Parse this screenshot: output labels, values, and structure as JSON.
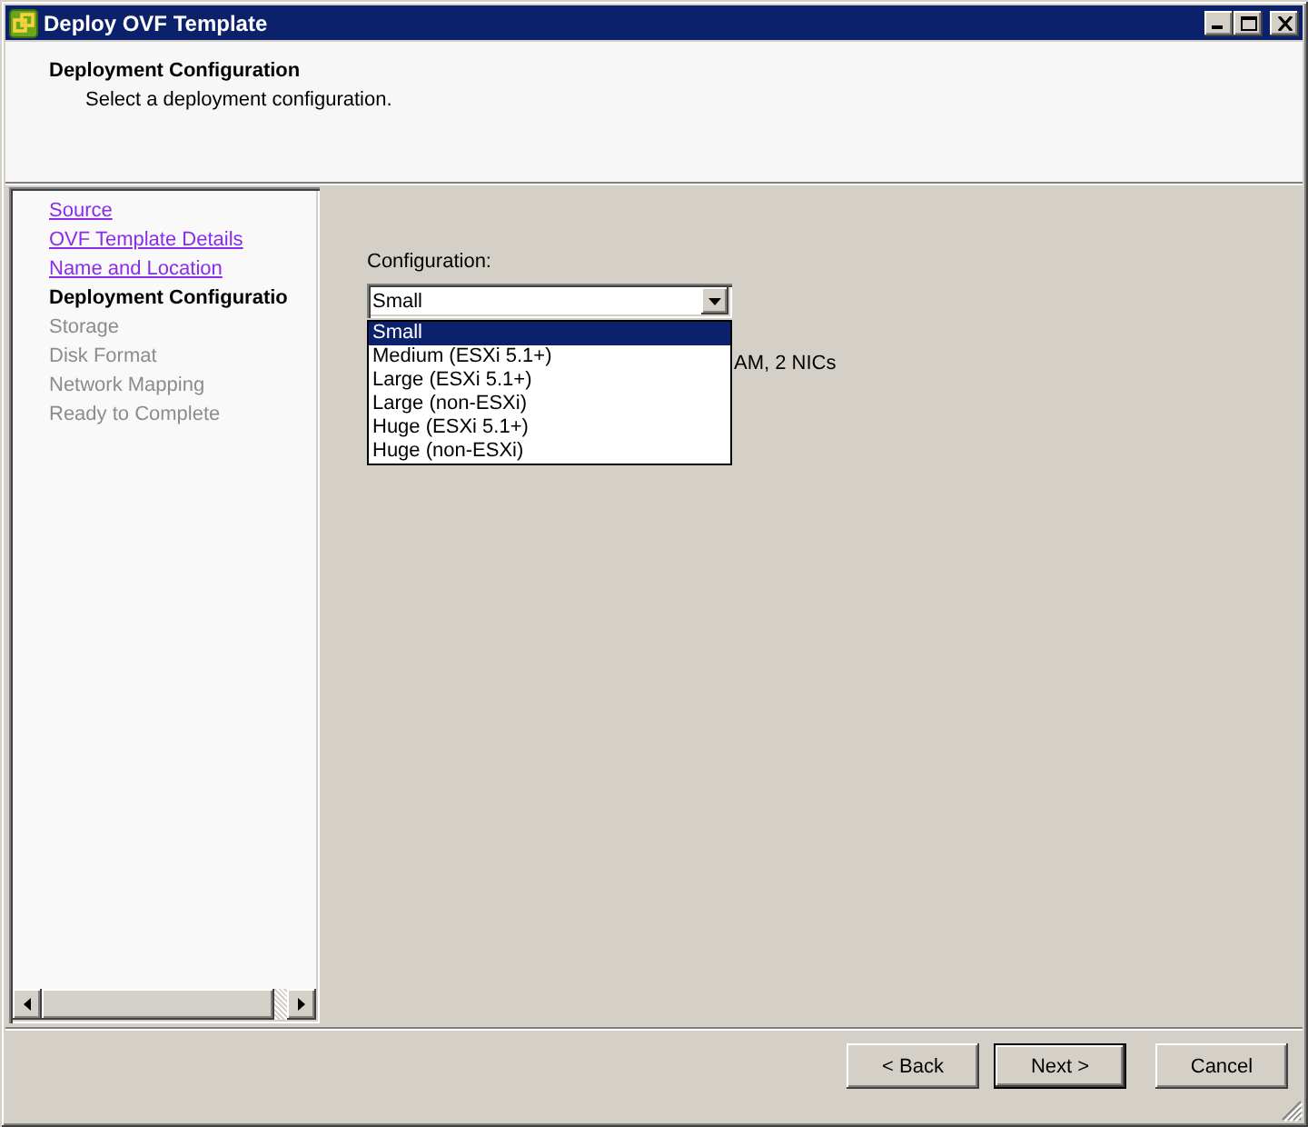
{
  "window": {
    "title": "Deploy OVF Template"
  },
  "header": {
    "title": "Deployment Configuration",
    "subtitle": "Select a deployment configuration."
  },
  "steps": [
    {
      "label": "Source",
      "selected": false,
      "disabled": false
    },
    {
      "label": "OVF Template Details",
      "selected": false,
      "disabled": false
    },
    {
      "label": "Name and Location",
      "selected": false,
      "disabled": false
    },
    {
      "label": "Deployment Configuratio",
      "selected": true,
      "disabled": false
    },
    {
      "label": "Storage",
      "selected": false,
      "disabled": true
    },
    {
      "label": "Disk Format",
      "selected": false,
      "disabled": true
    },
    {
      "label": "Network Mapping",
      "selected": false,
      "disabled": true
    },
    {
      "label": "Ready to Complete",
      "selected": false,
      "disabled": true
    }
  ],
  "configuration": {
    "label": "Configuration:",
    "value": "Small",
    "expanded": true,
    "options": [
      {
        "label": "Small",
        "selected": true
      },
      {
        "label": "Medium (ESXi 5.1+)",
        "selected": false
      },
      {
        "label": "Large (ESXi 5.1+)",
        "selected": false
      },
      {
        "label": "Large (non-ESXi)",
        "selected": false
      },
      {
        "label": "Huge (ESXi 5.1+)",
        "selected": false
      },
      {
        "label": "Huge (non-ESXi)",
        "selected": false
      }
    ]
  },
  "description": "AM, 2 NICs",
  "buttons": [
    {
      "label": "< Back",
      "default": false
    },
    {
      "label": "Next >",
      "default": true
    },
    {
      "label": "Cancel",
      "default": false
    }
  ]
}
